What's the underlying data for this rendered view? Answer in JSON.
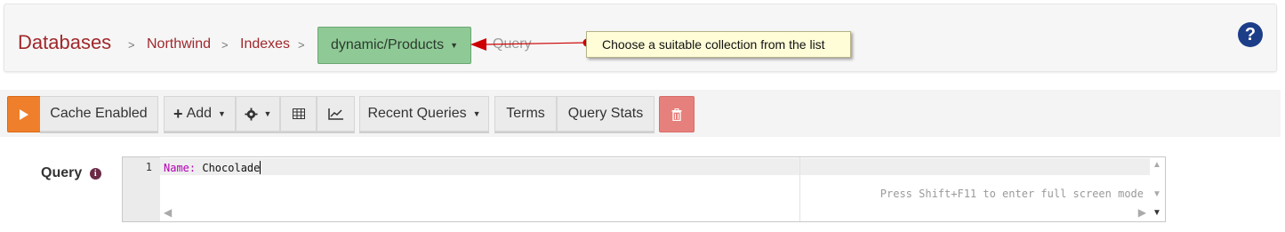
{
  "breadcrumb": {
    "root": "Databases",
    "items": [
      "Northwind",
      "Indexes"
    ],
    "separator": ">",
    "collection": "dynamic/Products",
    "current": "Query"
  },
  "annotation": {
    "text": "Choose a suitable collection from the list",
    "arrow_color": "#cc0000"
  },
  "help": {
    "icon": "question-circle-icon",
    "glyph": "?"
  },
  "toolbar": {
    "run_icon": "play-icon",
    "cache_label": "Cache Enabled",
    "add_label": "Add",
    "settings_icon": "gear-icon",
    "table_icon": "table-icon",
    "chart_icon": "line-chart-icon",
    "recent_label": "Recent Queries",
    "terms_label": "Terms",
    "stats_label": "Query Stats",
    "delete_icon": "trash-icon"
  },
  "query": {
    "label": "Query",
    "info_glyph": "i",
    "line_number": "1",
    "keyword": "Name:",
    "value": " Chocolade",
    "hint": "Press Shift+F11 to enter full screen mode"
  },
  "colors": {
    "brand": "#a0282c",
    "collection_bg": "#8fca96",
    "run_orange": "#ef7f2a",
    "delete_red": "#e6807c",
    "help_blue": "#1c3e88"
  }
}
